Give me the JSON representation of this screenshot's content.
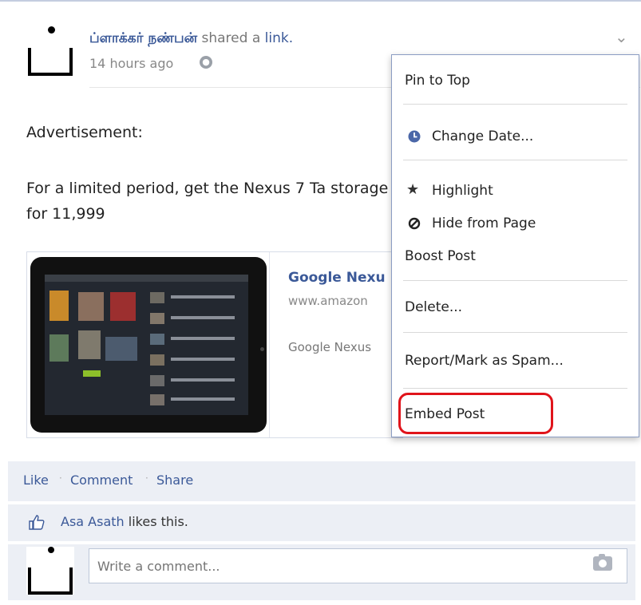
{
  "post": {
    "author": "ப்ளாக்கர் நண்பன்",
    "shared_text": " shared a ",
    "link_text": "link.",
    "time": "14 hours ago",
    "advertisement": "Advertisement:",
    "promo_text": "For a limited period, get the Nexus 7 Ta storage for 11,999"
  },
  "preview": {
    "title": "Google Nexu",
    "url": "www.amazon",
    "description": "Google Nexus"
  },
  "actions": {
    "like": "Like",
    "comment": "Comment",
    "share": "Share",
    "sep": "·"
  },
  "likes": {
    "name": "Asa Asath",
    "suffix": " likes this."
  },
  "comment": {
    "placeholder": "Write a comment..."
  },
  "menu": {
    "items": [
      {
        "label": "Pin to Top",
        "icon": ""
      },
      {
        "label": "Change Date...",
        "icon": "clock-icon"
      },
      {
        "label": "Highlight",
        "icon": "star-icon"
      },
      {
        "label": "Hide from Page",
        "icon": "hide-icon"
      },
      {
        "label": "Boost Post",
        "icon": ""
      },
      {
        "label": "Delete...",
        "icon": ""
      },
      {
        "label": "Report/Mark as Spam...",
        "icon": ""
      },
      {
        "label": "Embed Post",
        "icon": ""
      }
    ]
  },
  "colors": {
    "link_blue": "#3b5998",
    "action_bg": "#eceff5",
    "highlight_red": "#e0141b"
  }
}
